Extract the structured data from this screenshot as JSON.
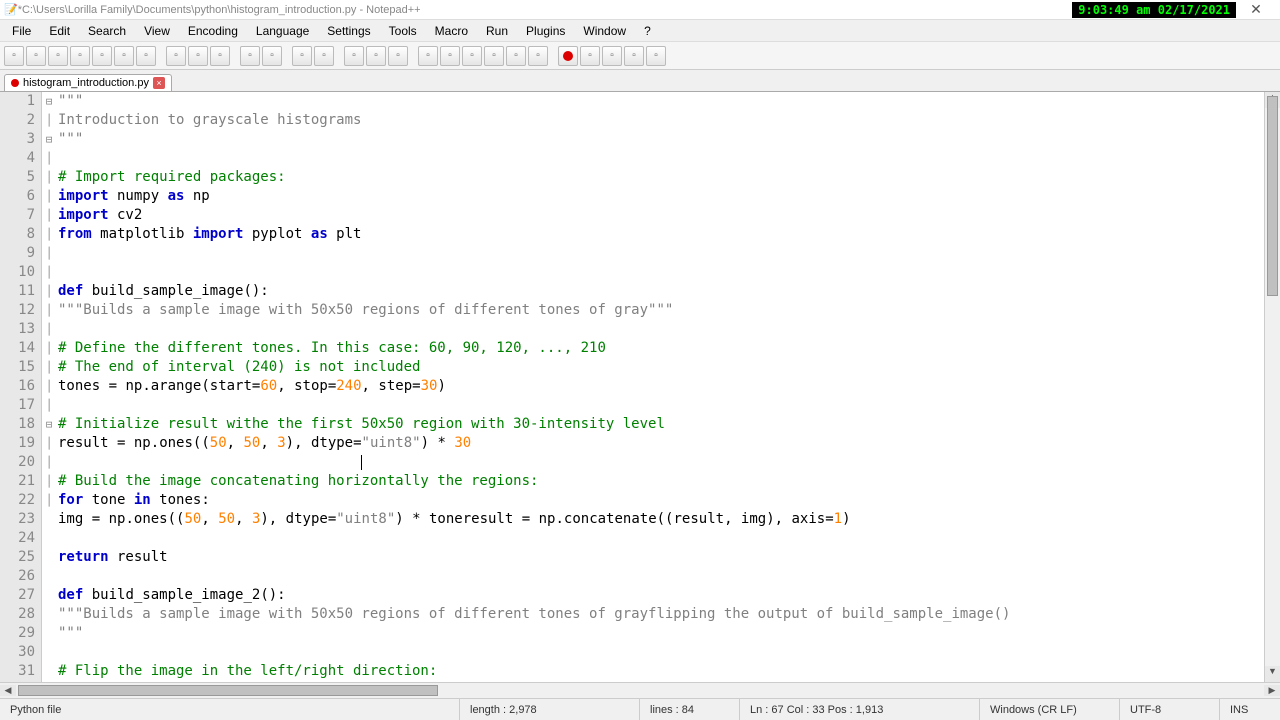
{
  "title_bar": {
    "path": "*C:\\Users\\Lorilla Family\\Documents\\python\\histogram_introduction.py - Notepad++",
    "clock": "9:03:49 am 02/17/2021"
  },
  "menu": [
    "File",
    "Edit",
    "Search",
    "View",
    "Encoding",
    "Language",
    "Settings",
    "Tools",
    "Macro",
    "Run",
    "Plugins",
    "Window",
    "?"
  ],
  "tab": {
    "name": "histogram_introduction.py"
  },
  "code_lines": [
    {
      "n": 1,
      "fold": "⊟",
      "html": "<span class='str'>\"\"\"</span>"
    },
    {
      "n": 2,
      "fold": "│",
      "html": "<span class='str'>Introduction to grayscale histograms</span>"
    },
    {
      "n": 3,
      "fold": "",
      "html": "<span class='str'>\"\"\"</span>"
    },
    {
      "n": 4,
      "fold": "",
      "html": ""
    },
    {
      "n": 5,
      "fold": "",
      "html": "<span class='cmt'># Import required packages:</span>"
    },
    {
      "n": 6,
      "fold": "",
      "html": "<span class='kw'>import</span> numpy <span class='kw'>as</span> np"
    },
    {
      "n": 7,
      "fold": "",
      "html": "<span class='kw'>import</span> cv2"
    },
    {
      "n": 8,
      "fold": "",
      "html": "<span class='kw'>from</span> matplotlib <span class='kw'>import</span> pyplot <span class='kw'>as</span> plt"
    },
    {
      "n": 9,
      "fold": "",
      "html": ""
    },
    {
      "n": 10,
      "fold": "",
      "html": ""
    },
    {
      "n": 11,
      "fold": "⊟",
      "html": "<span class='kw'>def</span> build_sample_image<span class='op'>():</span>"
    },
    {
      "n": 12,
      "fold": "│",
      "html": "<span class='str'>\"\"\"Builds a sample image with 50x50 regions of different tones of gray\"\"\"</span>"
    },
    {
      "n": 13,
      "fold": "│",
      "html": ""
    },
    {
      "n": 14,
      "fold": "│",
      "html": "<span class='cmt'># Define the different tones. In this case: 60, 90, 120, ..., 210</span>"
    },
    {
      "n": 15,
      "fold": "│",
      "html": "<span class='cmt'># The end of interval (240) is not included</span>"
    },
    {
      "n": 16,
      "fold": "│",
      "html": "tones <span class='op'>=</span> np<span class='op'>.</span>arange<span class='op'>(</span>start<span class='op'>=</span><span class='num'>60</span><span class='op'>,</span> stop<span class='op'>=</span><span class='num'>240</span><span class='op'>,</span> step<span class='op'>=</span><span class='num'>30</span><span class='op'>)</span>"
    },
    {
      "n": 17,
      "fold": "│",
      "html": ""
    },
    {
      "n": 18,
      "fold": "│",
      "html": "<span class='cmt'># Initialize result withe the first 50x50 region with 30-intensity level</span>"
    },
    {
      "n": 19,
      "fold": "│",
      "html": "result <span class='op'>=</span> np<span class='op'>.</span>ones<span class='op'>((</span><span class='num'>50</span><span class='op'>,</span> <span class='num'>50</span><span class='op'>,</span> <span class='num'>3</span><span class='op'>),</span> dtype<span class='op'>=</span><span class='str'>\"uint8\"</span><span class='op'>)</span> <span class='op'>*</span> <span class='num'>30</span>"
    },
    {
      "n": 20,
      "fold": "│",
      "html": "                                    <span class='caret'></span>"
    },
    {
      "n": 21,
      "fold": "│",
      "html": "<span class='cmt'># Build the image concatenating horizontally the regions:</span>"
    },
    {
      "n": 22,
      "fold": "│",
      "html": "<span class='kw'>for</span> tone <span class='kw'>in</span> tones<span class='op'>:</span>"
    },
    {
      "n": 23,
      "fold": "│",
      "html": "img <span class='op'>=</span> np<span class='op'>.</span>ones<span class='op'>((</span><span class='num'>50</span><span class='op'>,</span> <span class='num'>50</span><span class='op'>,</span> <span class='num'>3</span><span class='op'>),</span> dtype<span class='op'>=</span><span class='str'>\"uint8\"</span><span class='op'>)</span> <span class='op'>*</span> toneresult <span class='op'>=</span> np<span class='op'>.</span>concatenate<span class='op'>((</span>result<span class='op'>,</span> img<span class='op'>),</span> axis<span class='op'>=</span><span class='num'>1</span><span class='op'>)</span>"
    },
    {
      "n": 24,
      "fold": "│",
      "html": ""
    },
    {
      "n": 25,
      "fold": "│",
      "html": "<span class='kw'>return</span> result"
    },
    {
      "n": 26,
      "fold": "",
      "html": ""
    },
    {
      "n": 27,
      "fold": "⊟",
      "html": "<span class='kw'>def</span> build_sample_image_2<span class='op'>():</span>"
    },
    {
      "n": 28,
      "fold": "│",
      "html": "<span class='str'>\"\"\"Builds a sample image with 50x50 regions of different tones of grayflipping the output of build_sample_image()</span>"
    },
    {
      "n": 29,
      "fold": "│",
      "html": "<span class='str'>\"\"\"</span>"
    },
    {
      "n": 30,
      "fold": "│",
      "html": ""
    },
    {
      "n": 31,
      "fold": "│",
      "html": "<span class='cmt'># Flip the image in the left/right direction:</span>"
    }
  ],
  "status": {
    "filetype": "Python file",
    "length": "length : 2,978",
    "lines": "lines : 84",
    "pos": "Ln : 67   Col : 33   Pos : 1,913",
    "eol": "Windows (CR LF)",
    "enc": "UTF-8",
    "ins": "INS"
  },
  "toolbar_icons": [
    "new",
    "open",
    "save",
    "save-all",
    "close",
    "close-all",
    "print",
    "",
    "cut",
    "copy",
    "paste",
    "",
    "undo",
    "redo",
    "",
    "find",
    "replace",
    "",
    "zoom-in",
    "zoom-out",
    "sync",
    "",
    "wrap",
    "all-chars",
    "indent",
    "lang",
    "folder",
    "monitor",
    "",
    "rec",
    "stop",
    "play",
    "play-multi",
    "save-macro"
  ]
}
